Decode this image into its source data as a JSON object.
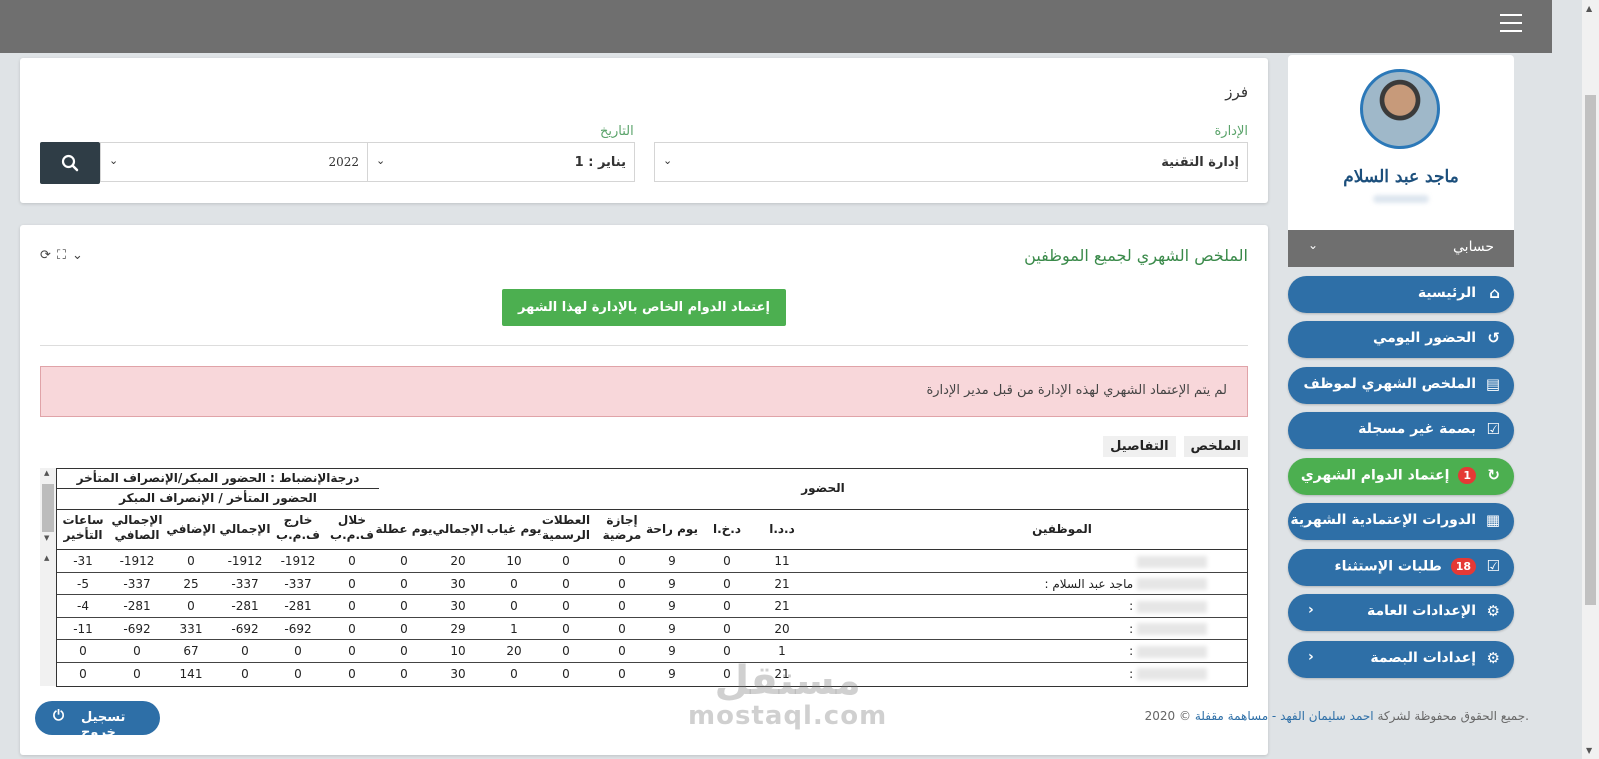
{
  "header": {
    "menu_icon": "hamburger-icon"
  },
  "profile": {
    "name": "ماجد عبد السلام",
    "account_label": "حسابي"
  },
  "nav": [
    {
      "label": "الرئيسية",
      "icon": "home-icon",
      "glyph": "⌂"
    },
    {
      "label": "الحضور اليومي",
      "icon": "history-icon",
      "glyph": "↺"
    },
    {
      "label": "الملخص الشهري لموظف",
      "icon": "document-icon",
      "glyph": "▤"
    },
    {
      "label": "بصمة غير مسجلة",
      "icon": "checkbox-icon",
      "glyph": "☑"
    },
    {
      "label": "إعتماد الدوام الشهري",
      "icon": "approve-icon",
      "glyph": "↻",
      "badge": "1"
    },
    {
      "label": "الدورات الإعتمادية الشهرية",
      "icon": "table-icon",
      "glyph": "▦"
    },
    {
      "label": "طلبات الإستثناء",
      "icon": "checkbox-icon",
      "glyph": "☑",
      "badge": "18"
    },
    {
      "label": "الإعدادات العامة",
      "icon": "cogs-icon",
      "glyph": "⚙"
    },
    {
      "label": "إعدادات البصمة",
      "icon": "cogs-icon",
      "glyph": "⚙"
    }
  ],
  "filter": {
    "title": "فرز",
    "department_label": "الإدارة",
    "department_value": "إدارة التقنية",
    "date_label": "التاريخ",
    "month_value": "1 : يناير",
    "year_value": "2022"
  },
  "summary": {
    "title": "الملخص الشهري لجميع الموظفين",
    "approve_button": "إعتماد الدوام الخاص بالإدارة لهذا الشهر",
    "alert": "لم يتم الإعتماد الشهري لهذه الإدارة من قبل مدير الإدارة",
    "tab_summary": "الملخص",
    "tab_details": "التفاصيل"
  },
  "table": {
    "group_attendance": "الحضور",
    "group_discipline": "درجةالإنضباط : الحضور المبكر/الإنصراف المتأخر",
    "group_late": "الحضور المتأخر / الإنصراف المبكر",
    "col_employees": "الموظفين",
    "columns": [
      "د.د.ا",
      "د.خ.ا",
      "يوم راحة",
      "إجازة مرضية",
      "العطلات الرسمية",
      "يوم غياب",
      "الإجمالي",
      "يوم عطلة",
      "خلال ف.م.ب",
      "خارج ف.م.ب",
      "الإجمالي",
      "الإضافي",
      "الإجمالي الصافي",
      "ساعات التأخير"
    ],
    "rows": [
      {
        "name": "",
        "values": [
          "11",
          "0",
          "9",
          "0",
          "0",
          "10",
          "20",
          "0",
          "0",
          "-1912",
          "-1912",
          "0",
          "-1912",
          "-31"
        ]
      },
      {
        "name": ": ماجد عبد السلام",
        "values": [
          "21",
          "0",
          "9",
          "0",
          "0",
          "0",
          "30",
          "0",
          "0",
          "-337",
          "-337",
          "25",
          "-337",
          "-5"
        ]
      },
      {
        "name": ":",
        "values": [
          "21",
          "0",
          "9",
          "0",
          "0",
          "0",
          "30",
          "0",
          "0",
          "-281",
          "-281",
          "0",
          "-281",
          "-4"
        ]
      },
      {
        "name": ":",
        "values": [
          "20",
          "0",
          "9",
          "0",
          "0",
          "1",
          "29",
          "0",
          "0",
          "-692",
          "-692",
          "331",
          "-692",
          "-11"
        ]
      },
      {
        "name": ":",
        "values": [
          "1",
          "0",
          "9",
          "0",
          "0",
          "20",
          "10",
          "0",
          "0",
          "0",
          "0",
          "67",
          "0",
          "0"
        ]
      },
      {
        "name": ":",
        "values": [
          "21",
          "0",
          "9",
          "0",
          "0",
          "0",
          "30",
          "0",
          "0",
          "0",
          "0",
          "141",
          "0",
          "0"
        ]
      }
    ]
  },
  "footer": {
    "prefix": "جميع الحقوق محفوظة لشركة",
    "company": "احمد سليمان الفهد - مساهمة مقفلة",
    "suffix": "© 2020."
  },
  "logout": "تسجيل خروج",
  "watermark": {
    "line1": "مستقل",
    "line2": "mostaql.com"
  },
  "colors": {
    "primary": "#2e6fa7",
    "success": "#4caf50",
    "topbar": "#6f6f6f",
    "alert_bg": "#f8d7da"
  }
}
